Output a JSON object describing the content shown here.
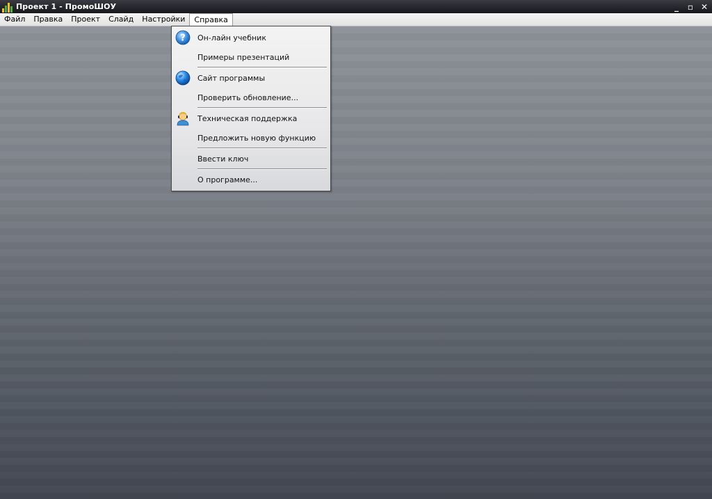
{
  "window": {
    "title": "Проект 1 - ПромоШОУ",
    "controls": [
      "_",
      "▫",
      "✕"
    ]
  },
  "menubar": {
    "items": [
      {
        "label": "Файл"
      },
      {
        "label": "Правка"
      },
      {
        "label": "Проект"
      },
      {
        "label": "Слайд"
      },
      {
        "label": "Настройки"
      },
      {
        "label": "Справка"
      }
    ],
    "active_index": 5
  },
  "help_menu": {
    "items": [
      {
        "label": "Он-лайн учебник",
        "icon": "help-icon"
      },
      {
        "label": "Примеры презентаций",
        "icon": ""
      },
      {
        "label": "Сайт программы",
        "icon": "globe-icon"
      },
      {
        "label": "Проверить обновление...",
        "icon": ""
      },
      {
        "label": "Техническая поддержка",
        "icon": "support-agent-icon"
      },
      {
        "label": "Предложить новую функцию",
        "icon": ""
      },
      {
        "label": "Ввести ключ",
        "icon": ""
      },
      {
        "label": "О программе...",
        "icon": ""
      }
    ]
  },
  "colors": {
    "titlebar": "#17171c",
    "menubar": "#e8e8e8",
    "workspace_top": "#8d9299",
    "workspace_bottom": "#414650"
  }
}
